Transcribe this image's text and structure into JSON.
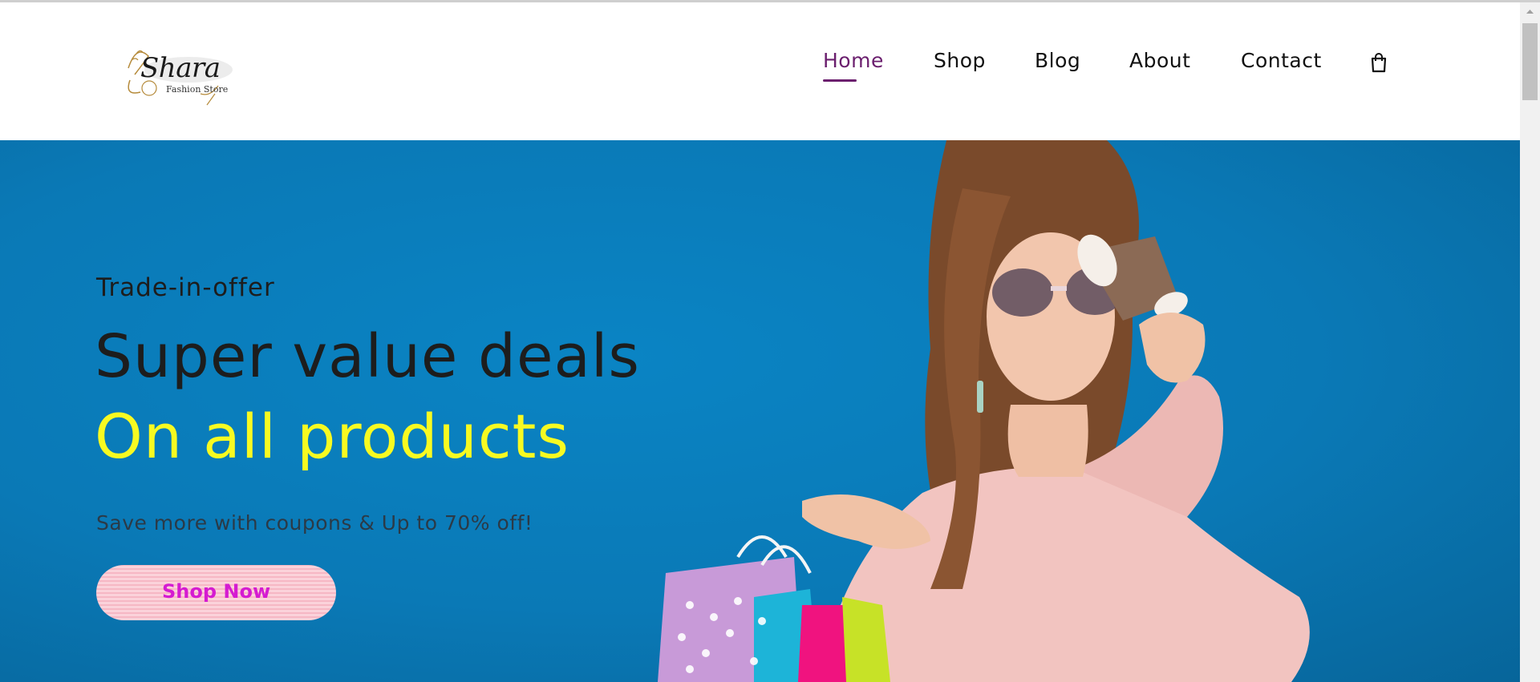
{
  "brand": {
    "name": "Shara",
    "tagline": "Fashion Store"
  },
  "nav": {
    "items": [
      {
        "label": "Home",
        "active": true
      },
      {
        "label": "Shop",
        "active": false
      },
      {
        "label": "Blog",
        "active": false
      },
      {
        "label": "About",
        "active": false
      },
      {
        "label": "Contact",
        "active": false
      }
    ],
    "cart_icon": "shopping-bag-icon",
    "active_color": "#6b1f6e"
  },
  "hero": {
    "eyebrow": "Trade-in-offer",
    "headline_line1": "Super value deals",
    "headline_line2": "On all products",
    "subtext": "Save more with coupons & Up to 70% off!",
    "cta_label": "Shop Now",
    "background_color": "#0a7fc0",
    "highlight_color": "#f8fa21",
    "cta_text_color": "#d51bd1"
  }
}
